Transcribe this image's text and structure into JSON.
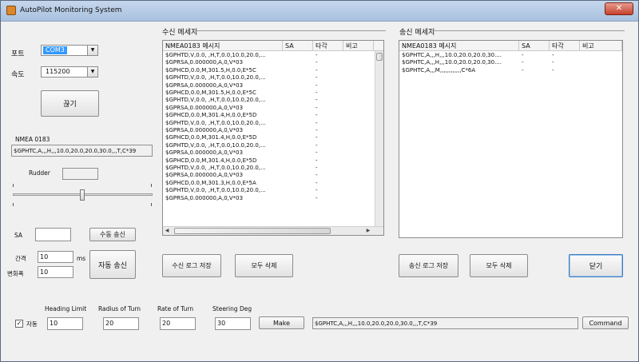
{
  "window": {
    "title": "AutoPilot Monitoring System",
    "close_label": "✕"
  },
  "port": {
    "label": "포트",
    "value": "COM3"
  },
  "speed": {
    "label": "속도",
    "value": "115200"
  },
  "disconnect_label": "끊기",
  "nmea": {
    "label": "NMEA 0183",
    "value": "$GPHTC,A,,,H,,,10.0,20.0,20.0,30.0,,,T,C*39"
  },
  "rudder": {
    "label": "Rudder",
    "value": ""
  },
  "sa": {
    "label": "SA",
    "value": "",
    "manual_send_label": "수동 송신"
  },
  "interval": {
    "label": "간격",
    "value": "10",
    "unit": "ms"
  },
  "variation": {
    "label": "변화폭",
    "value": "10"
  },
  "auto_send_label": "자동 송신",
  "received": {
    "title": "수신 메세지",
    "columns": [
      "NMEA0183 메시지",
      "SA",
      "타각",
      "비고"
    ],
    "rows": [
      [
        "$GPHTD,V,0.0, ,H,T,0.0,10.0,20.0,...",
        "",
        "-",
        ""
      ],
      [
        "$GPRSA,0.000000,A,0,V*03",
        "",
        "-",
        ""
      ],
      [
        "$GPHCD,0.0,M,301.5,H,0.0,E*5C",
        "",
        "-",
        ""
      ],
      [
        "$GPHTD,V,0.0, ,H,T,0.0,10.0,20.0,...",
        "",
        "-",
        ""
      ],
      [
        "$GPRSA,0.000000,A,0,V*03",
        "",
        "-",
        ""
      ],
      [
        "$GPHCD,0.0,M,301.5,H,0.0,E*5C",
        "",
        "-",
        ""
      ],
      [
        "$GPHTD,V,0.0, ,H,T,0.0,10.0,20.0,...",
        "",
        "-",
        ""
      ],
      [
        "$GPRSA,0.000000,A,0,V*03",
        "",
        "-",
        ""
      ],
      [
        "$GPHCD,0.0,M,301.4,H,0.0,E*5D",
        "",
        "-",
        ""
      ],
      [
        "$GPHTD,V,0.0, ,H,T,0.0,10.0,20.0,...",
        "",
        "-",
        ""
      ],
      [
        "$GPRSA,0.000000,A,0,V*03",
        "",
        "-",
        ""
      ],
      [
        "$GPHCD,0.0,M,301.4,H,0.0,E*5D",
        "",
        "-",
        ""
      ],
      [
        "$GPHTD,V,0.0, ,H,T,0.0,10.0,20.0,...",
        "",
        "-",
        ""
      ],
      [
        "$GPRSA,0.000000,A,0,V*03",
        "",
        "-",
        ""
      ],
      [
        "$GPHCD,0.0,M,301.4,H,0.0,E*5D",
        "",
        "-",
        ""
      ],
      [
        "$GPHTD,V,0.0, ,H,T,0.0,10.0,20.0,...",
        "",
        "-",
        ""
      ],
      [
        "$GPRSA,0.000000,A,0,V*03",
        "",
        "-",
        ""
      ],
      [
        "$GPHCD,0.0,M,301.3,H,0.0,E*5A",
        "",
        "-",
        ""
      ],
      [
        "$GPHTD,V,0.0, ,H,T,0.0,10.0,20.0,...",
        "",
        "-",
        ""
      ],
      [
        "$GPRSA,0.000000,A,0,V*03",
        "",
        "-",
        ""
      ]
    ],
    "save_log_label": "수신 로그 저장",
    "clear_all_label": "모두 삭제"
  },
  "sent": {
    "title": "송신 메세지",
    "columns": [
      "NMEA0183 메시지",
      "SA",
      "타각",
      "비고"
    ],
    "rows": [
      [
        "$GPHTC,A,,,H,,,10.0,20.0,20.0,30....",
        "-",
        "-",
        ""
      ],
      [
        "$GPHTC,A,,,H,,,10.0,20.0,20.0,30....",
        "-",
        "-",
        ""
      ],
      [
        "$GPHTC,A,,,M,,,,,,,,,,,,C*6A",
        "-",
        "-",
        ""
      ]
    ],
    "save_log_label": "송신 로그 저장",
    "clear_all_label": "모두 삭제"
  },
  "close_label": "닫기",
  "auto": {
    "label": "자동",
    "checked": "✓"
  },
  "heading_limit": {
    "label": "Heading Limit",
    "value": "10"
  },
  "radius_of_turn": {
    "label": "Radius of Turn",
    "value": "20"
  },
  "rate_of_turn": {
    "label": "Rate of Turn",
    "value": "20"
  },
  "steering_deg": {
    "label": "Steering Deg",
    "value": "30"
  },
  "make_label": "Make",
  "command": {
    "value": "$GPHTC,A,,,H,,,10.0,20.0,20.0,30.0,,,T,C*39",
    "label": "Command"
  }
}
